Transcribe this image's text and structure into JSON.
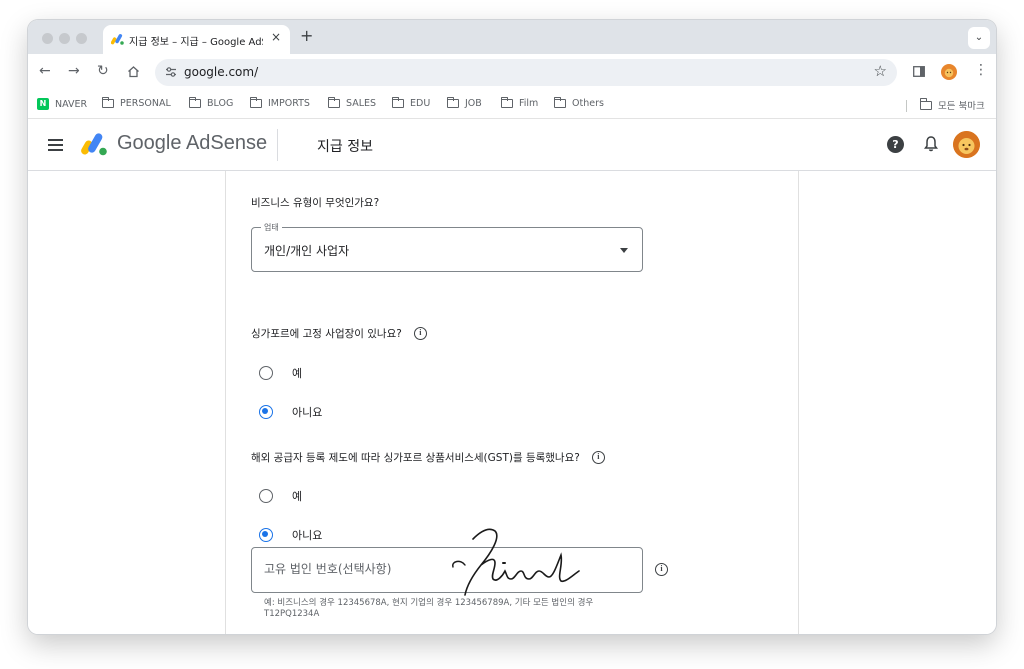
{
  "browser": {
    "tab_title": "지급 정보 – 지급 – Google AdSense",
    "tab_close": "×",
    "new_tab": "+",
    "tab_menu": "⌄",
    "url": "google.com/",
    "bookmarks": [
      {
        "label": "NAVER",
        "icon": "naver-icon"
      },
      {
        "label": "PERSONAL",
        "icon": "folder-icon"
      },
      {
        "label": "BLOG",
        "icon": "folder-icon"
      },
      {
        "label": "IMPORTS",
        "icon": "folder-icon"
      },
      {
        "label": "SALES",
        "icon": "folder-icon"
      },
      {
        "label": "EDU",
        "icon": "folder-icon"
      },
      {
        "label": "JOB",
        "icon": "folder-icon"
      },
      {
        "label": "Film",
        "icon": "folder-icon"
      },
      {
        "label": "Others",
        "icon": "folder-icon"
      }
    ],
    "all_bookmarks": "모든 북마크"
  },
  "app": {
    "brand": "Google AdSense",
    "page_title": "지급 정보",
    "help_glyph": "?"
  },
  "form": {
    "business_type_question": "비즈니스 유형이 무엇인가요?",
    "business_type_legend": "업태",
    "business_type_value": "개인/개인 사업자",
    "fixed_place_question": "싱가포르에 고정 사업장이 있나요?",
    "fixed_place_options": [
      {
        "label": "예",
        "checked": false
      },
      {
        "label": "아니요",
        "checked": true
      }
    ],
    "gst_question": "해외 공급자 등록 제도에 따라 싱가포르 상품서비스세(GST)를 등록했나요?",
    "gst_options": [
      {
        "label": "예",
        "checked": false
      },
      {
        "label": "아니요",
        "checked": true
      }
    ],
    "entity_number_placeholder": "고유 법인 번호(선택사항)",
    "entity_number_hint": "예: 비즈니스의 경우 12345678A, 현지 기업의 경우 123456789A, 기타 모든 법인의 경우 T12PQ1234A",
    "info_glyph": "i"
  },
  "colors": {
    "accent": "#1a73e8",
    "adsense_yellow": "#fbbc04",
    "adsense_blue": "#4285f4",
    "adsense_green": "#34a853"
  },
  "watermark_signature": "hiword"
}
